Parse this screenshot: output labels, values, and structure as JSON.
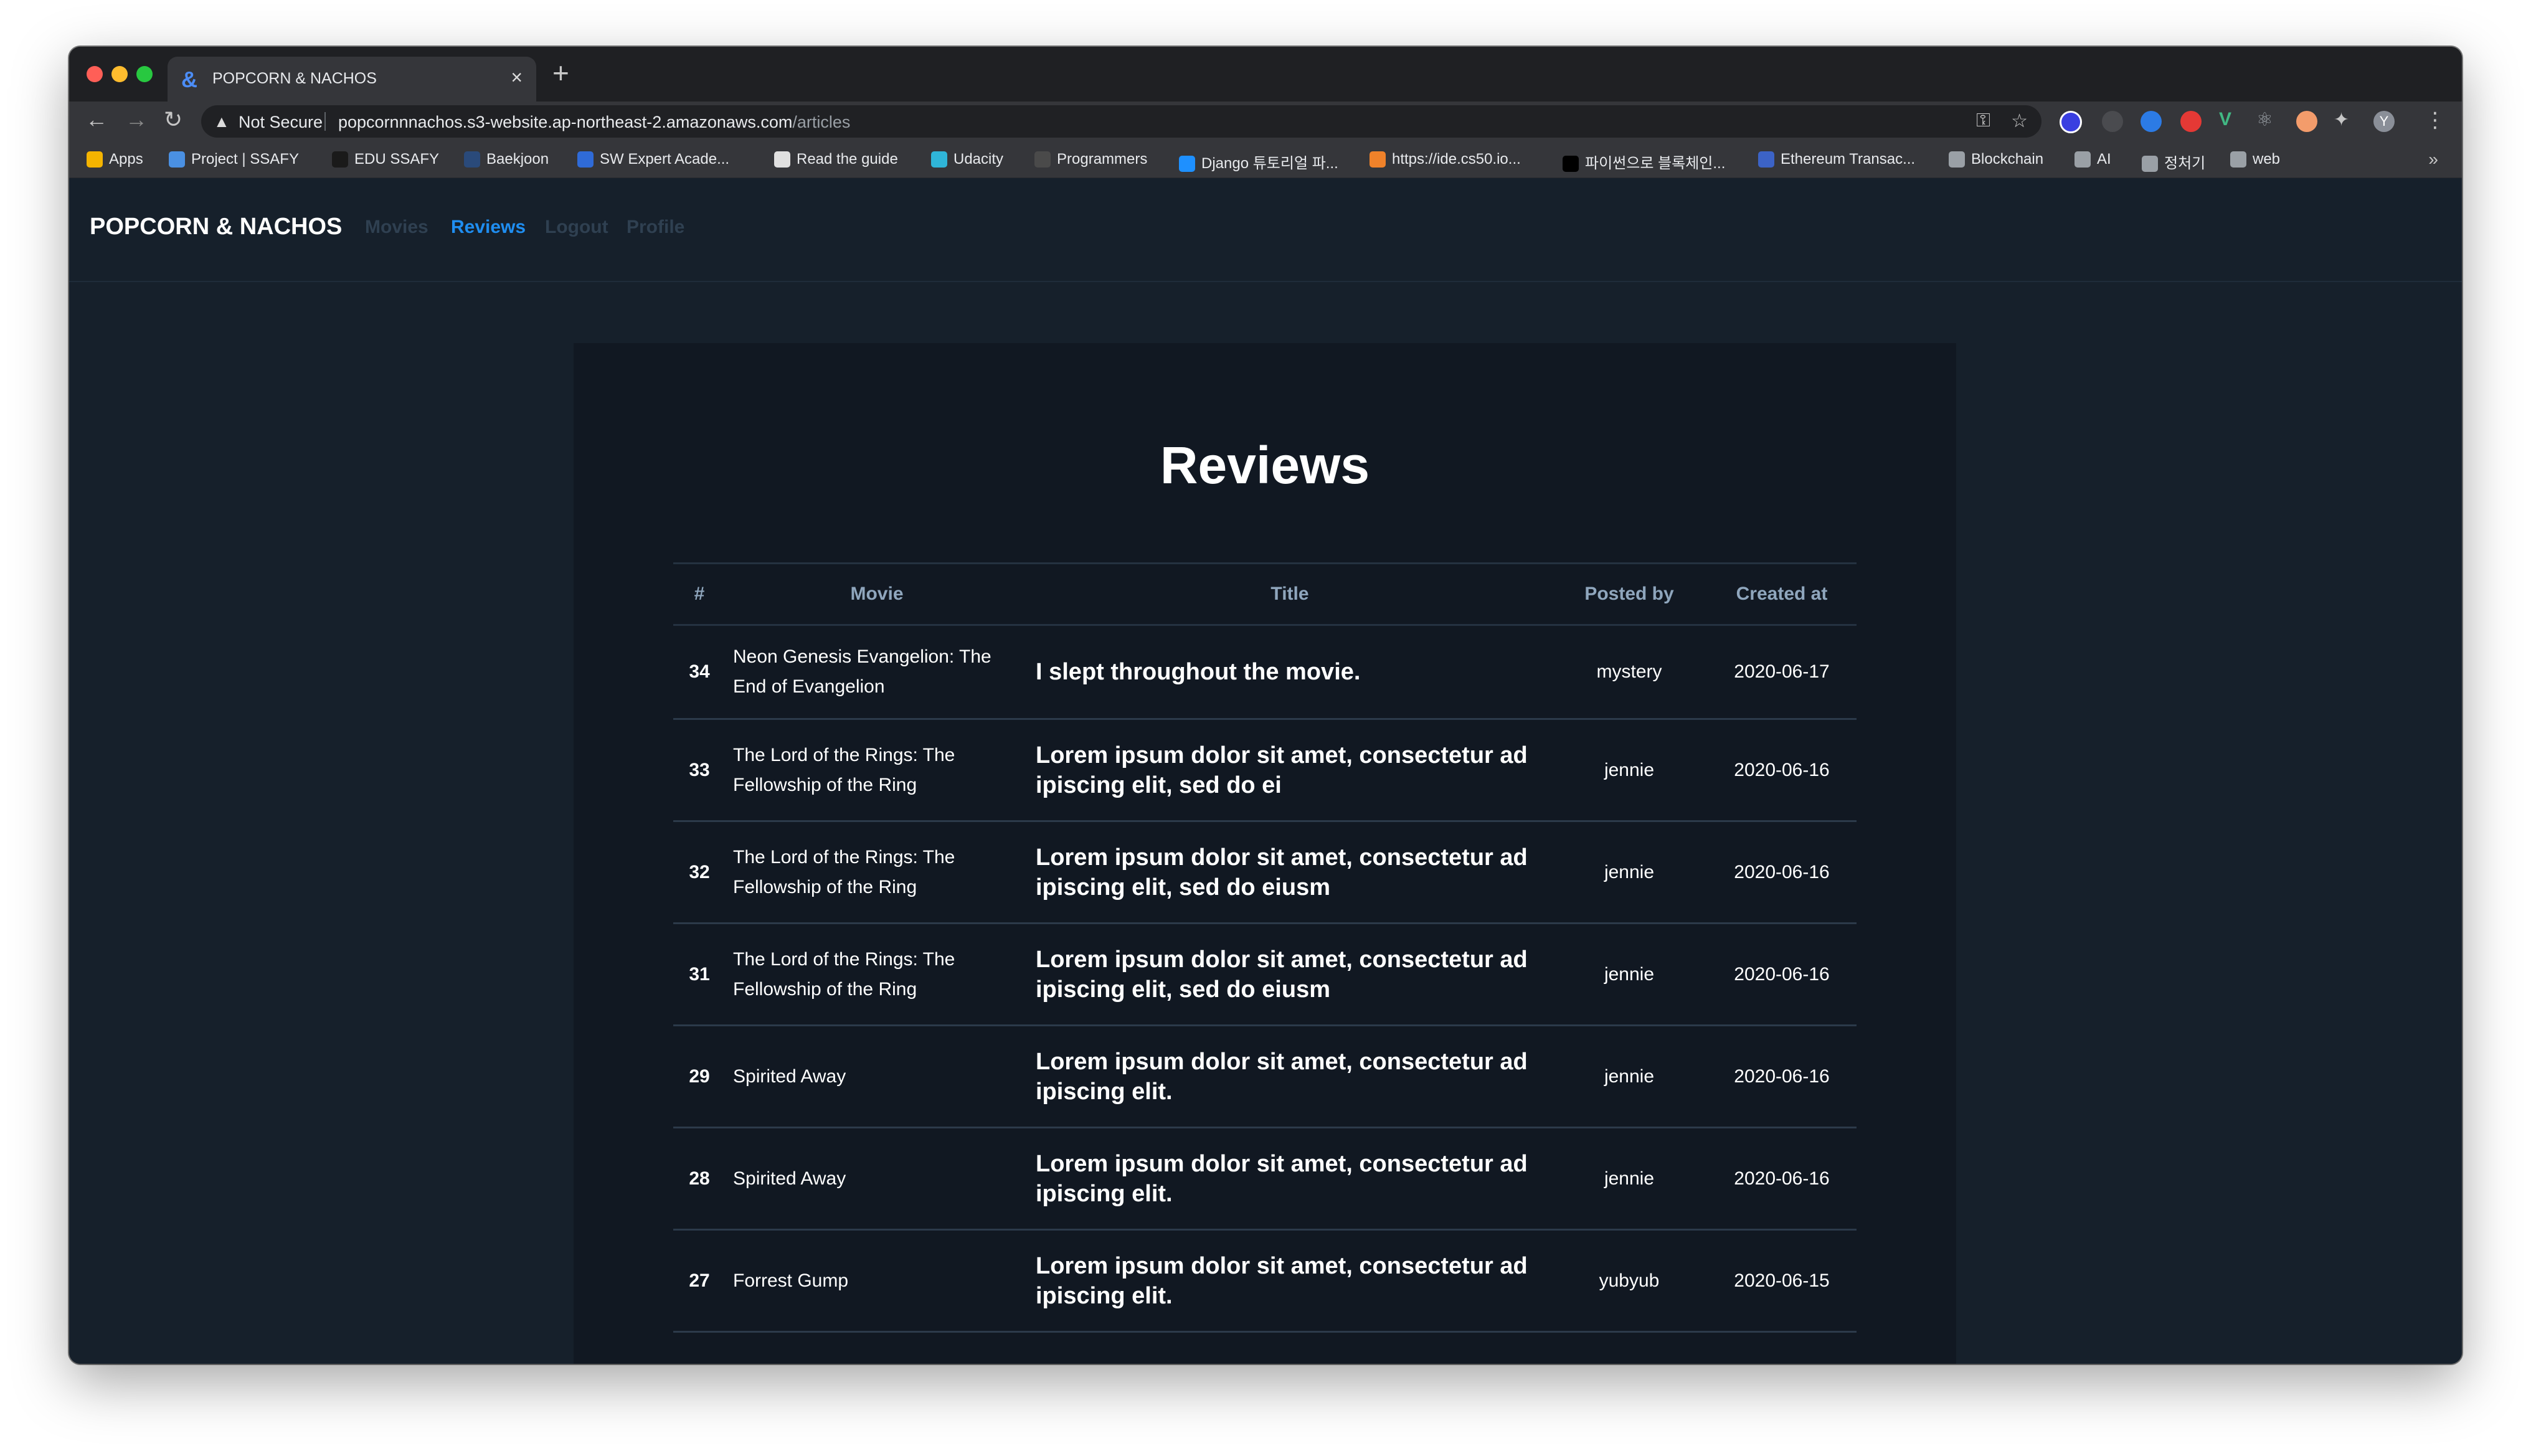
{
  "browser": {
    "tab": {
      "icon": "&",
      "title": "POPCORN & NACHOS",
      "close": "×"
    },
    "new_tab": "+",
    "omnibox": {
      "security": "Not Secure",
      "url_host": "popcornnnachos.s3-website.ap-northeast-2.amazonaws.com",
      "url_path": "/articles"
    },
    "bookmarks": [
      {
        "label": "Apps",
        "color": "#f4b400"
      },
      {
        "label": "Project | SSAFY",
        "color": "#4a90e2"
      },
      {
        "label": "EDU SSAFY",
        "color": "#1a1a1a"
      },
      {
        "label": "Baekjoon",
        "color": "#2a4a7a"
      },
      {
        "label": "SW Expert Acade...",
        "color": "#2f6bd8"
      },
      {
        "label": "Read the guide",
        "color": "#e0e0e0"
      },
      {
        "label": "Udacity",
        "color": "#2fb5d8"
      },
      {
        "label": "Programmers",
        "color": "#4a4a4a"
      },
      {
        "label": "Django 튜토리얼 파...",
        "color": "#1e90ff"
      },
      {
        "label": "https://ide.cs50.io...",
        "color": "#f0822a"
      },
      {
        "label": "파이썬으로 블록체인...",
        "color": "#000000"
      },
      {
        "label": "Ethereum Transac...",
        "color": "#3c63c6"
      },
      {
        "label": "Blockchain",
        "color": "#9aa0a6"
      },
      {
        "label": "AI",
        "color": "#9aa0a6"
      },
      {
        "label": "정처기",
        "color": "#9aa0a6"
      },
      {
        "label": "web",
        "color": "#9aa0a6"
      }
    ],
    "bookmarks_more": "»",
    "profile_initial": "Y"
  },
  "navbar": {
    "brand": "POPCORN & NACHOS",
    "links": [
      {
        "label": "Movies",
        "active": false
      },
      {
        "label": "Reviews",
        "active": true
      },
      {
        "label": "Logout",
        "active": false
      },
      {
        "label": "Profile",
        "active": false
      }
    ]
  },
  "main": {
    "title": "Reviews",
    "columns": [
      "#",
      "Movie",
      "Title",
      "Posted by",
      "Created at"
    ],
    "rows": [
      {
        "id": "34",
        "movie": "Neon Genesis Evangelion: The End of Evangelion",
        "title": "I slept throughout the movie.",
        "author": "mystery",
        "date": "2020-06-17"
      },
      {
        "id": "33",
        "movie": "The Lord of the Rings: The Fellowship of the Ring",
        "title": "Lorem ipsum dolor sit amet, consectetur ad ipiscing elit, sed do ei",
        "author": "jennie",
        "date": "2020-06-16"
      },
      {
        "id": "32",
        "movie": "The Lord of the Rings: The Fellowship of the Ring",
        "title": "Lorem ipsum dolor sit amet, consectetur ad ipiscing elit, sed do eiusm",
        "author": "jennie",
        "date": "2020-06-16"
      },
      {
        "id": "31",
        "movie": "The Lord of the Rings: The Fellowship of the Ring",
        "title": "Lorem ipsum dolor sit amet, consectetur ad ipiscing elit, sed do eiusm",
        "author": "jennie",
        "date": "2020-06-16"
      },
      {
        "id": "29",
        "movie": "Spirited Away",
        "title": "Lorem ipsum dolor sit amet, consectetur ad ipiscing elit.",
        "author": "jennie",
        "date": "2020-06-16"
      },
      {
        "id": "28",
        "movie": "Spirited Away",
        "title": "Lorem ipsum dolor sit amet, consectetur ad ipiscing elit.",
        "author": "jennie",
        "date": "2020-06-16"
      },
      {
        "id": "27",
        "movie": "Forrest Gump",
        "title": "Lorem ipsum dolor sit amet, consectetur ad ipiscing elit.",
        "author": "yubyub",
        "date": "2020-06-15"
      }
    ]
  }
}
